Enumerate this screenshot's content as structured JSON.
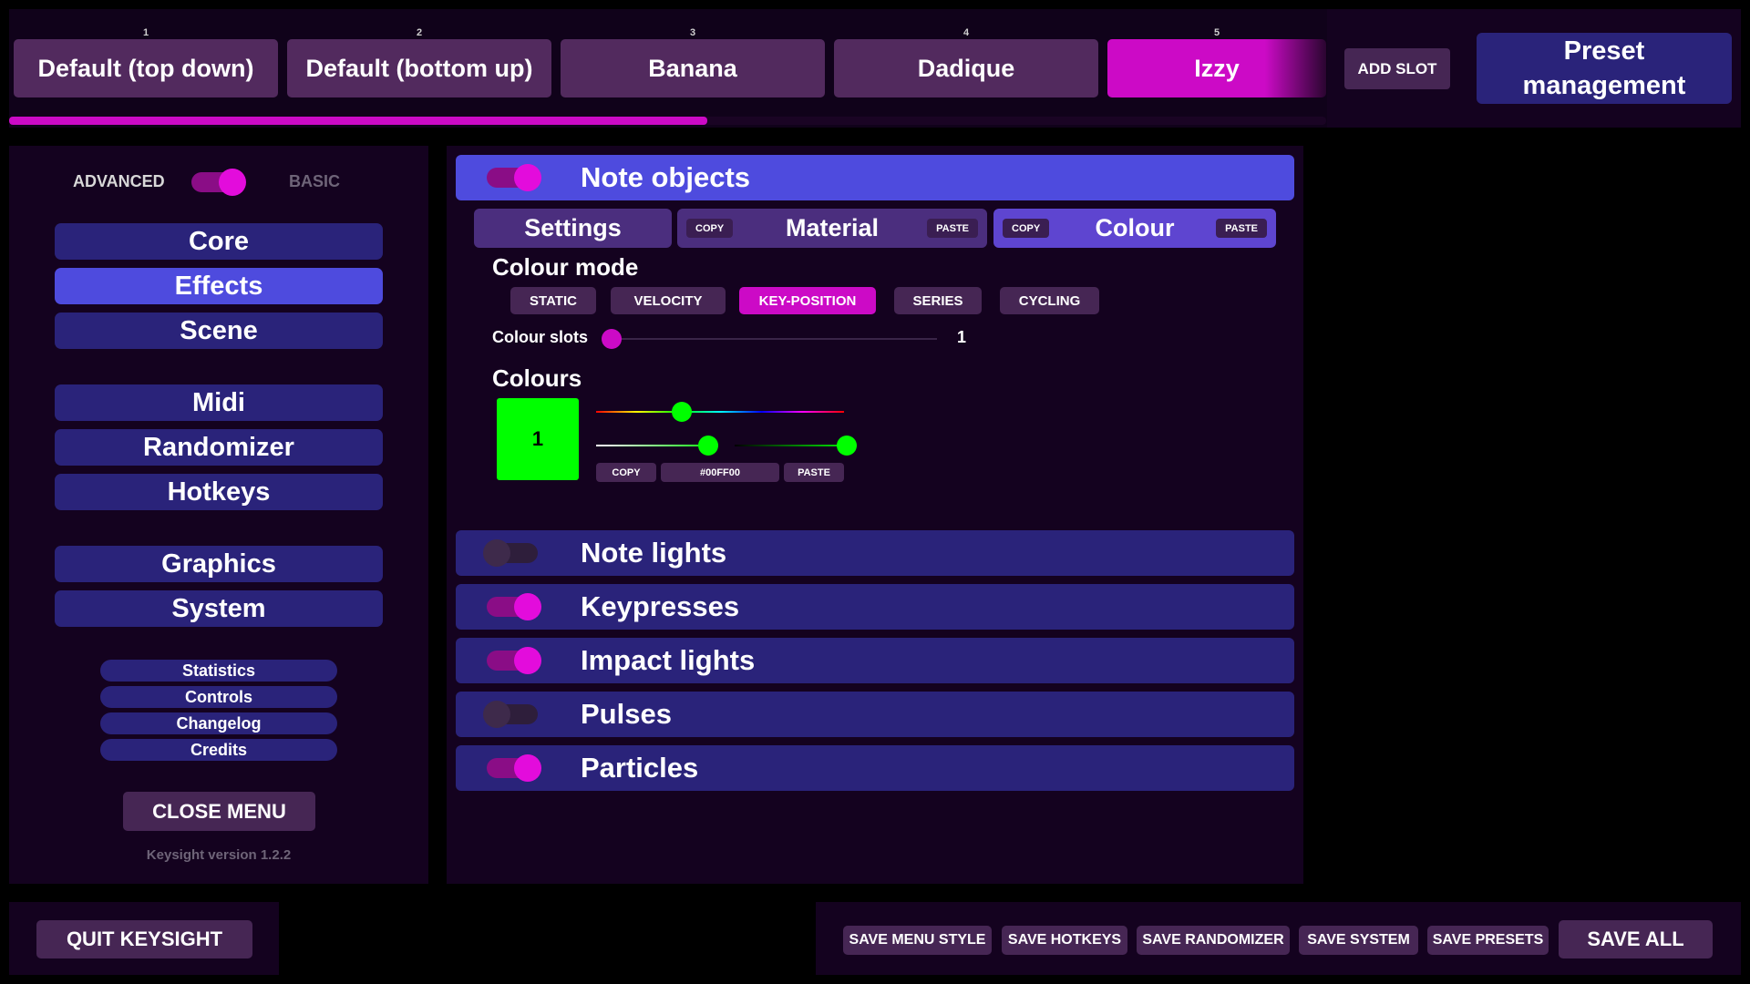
{
  "preset_bar": {
    "slots": [
      {
        "number": "1",
        "label": "Default (top down)"
      },
      {
        "number": "2",
        "label": "Default (bottom up)"
      },
      {
        "number": "3",
        "label": "Banana"
      },
      {
        "number": "4",
        "label": "Dadique"
      },
      {
        "number": "5",
        "label": "Izzy"
      }
    ],
    "active_slot_index": 4,
    "add_slot_label": "ADD SLOT",
    "preset_management_line1": "Preset",
    "preset_management_line2": "management",
    "progress_fraction": 0.53
  },
  "sidebar": {
    "mode_advanced_label": "ADVANCED",
    "mode_basic_label": "BASIC",
    "mode_toggle_on": true,
    "main_items": [
      "Core",
      "Effects",
      "Scene",
      "Midi",
      "Randomizer",
      "Hotkeys",
      "Graphics",
      "System"
    ],
    "active_item": "Effects",
    "small_items": [
      "Statistics",
      "Controls",
      "Changelog",
      "Credits"
    ],
    "close_menu_label": "CLOSE MENU",
    "version_text": "Keysight version 1.2.2"
  },
  "effects": {
    "note_objects": {
      "title": "Note objects",
      "enabled": true,
      "tabs": {
        "settings_label": "Settings",
        "material_label": "Material",
        "colour_label": "Colour",
        "copy_label": "COPY",
        "paste_label": "PASTE",
        "active_tab": "Colour"
      },
      "colour_mode_label": "Colour mode",
      "colour_modes": [
        "STATIC",
        "VELOCITY",
        "KEY-POSITION",
        "SERIES",
        "CYCLING"
      ],
      "active_colour_mode": "KEY-POSITION",
      "colour_slots_label": "Colour slots",
      "colour_slots_value": "1",
      "colour_slots_fraction": 0.0,
      "colours_label": "Colours",
      "colour_swatch": {
        "index_label": "1",
        "hex": "#00FF00",
        "hue_fraction": 0.33,
        "saturation_fraction": 1.0,
        "value_fraction": 1.0,
        "hex_text": "#00FF00",
        "copy_label": "COPY",
        "paste_label": "PASTE"
      }
    },
    "other_sections": [
      {
        "title": "Note lights",
        "enabled": false
      },
      {
        "title": "Keypresses",
        "enabled": true
      },
      {
        "title": "Impact lights",
        "enabled": true
      },
      {
        "title": "Pulses",
        "enabled": false
      },
      {
        "title": "Particles",
        "enabled": true
      }
    ]
  },
  "footer": {
    "quit_label": "QUIT KEYSIGHT",
    "save_menu_style_label": "SAVE MENU STYLE",
    "save_hotkeys_label": "SAVE HOTKEYS",
    "save_randomizer_label": "SAVE RANDOMIZER",
    "save_system_label": "SAVE SYSTEM",
    "save_presets_label": "SAVE PRESETS",
    "save_all_label": "SAVE ALL"
  },
  "colors": {
    "accent_magenta": "#CC0AC6",
    "active_blue": "#4E4BDE",
    "inactive_blue": "#2A237A",
    "panel_background": "#14021F",
    "swatch_green": "#00FF00"
  }
}
